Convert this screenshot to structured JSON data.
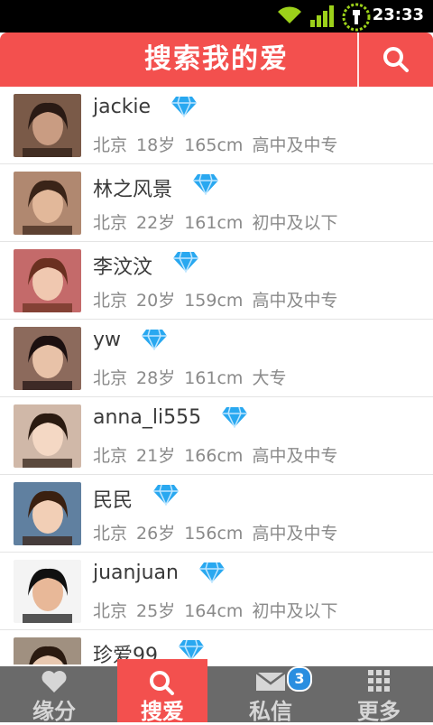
{
  "status_bar": {
    "time": "23:33"
  },
  "header": {
    "title": "搜索我的爱"
  },
  "profiles": [
    {
      "name": "jackie",
      "city": "北京",
      "age": "18岁",
      "height": "165cm",
      "education": "高中及中专"
    },
    {
      "name": "林之风景",
      "city": "北京",
      "age": "22岁",
      "height": "161cm",
      "education": "初中及以下"
    },
    {
      "name": "李汶汶",
      "city": "北京",
      "age": "20岁",
      "height": "159cm",
      "education": "高中及中专"
    },
    {
      "name": "yw",
      "city": "北京",
      "age": "28岁",
      "height": "161cm",
      "education": "大专"
    },
    {
      "name": "anna_li555",
      "city": "北京",
      "age": "21岁",
      "height": "166cm",
      "education": "高中及中专"
    },
    {
      "name": "民民",
      "city": "北京",
      "age": "26岁",
      "height": "156cm",
      "education": "高中及中专"
    },
    {
      "name": "juanjuan",
      "city": "北京",
      "age": "25岁",
      "height": "164cm",
      "education": "初中及以下"
    },
    {
      "name": "珍爱99",
      "city": "",
      "age": "",
      "height": "",
      "education": ""
    }
  ],
  "bottom_nav": {
    "items": [
      {
        "label": "缘分",
        "icon": "heart-icon"
      },
      {
        "label": "搜爱",
        "icon": "search-icon"
      },
      {
        "label": "私信",
        "icon": "mail-icon",
        "badge": "3"
      },
      {
        "label": "更多",
        "icon": "grid-icon"
      }
    ]
  },
  "colors": {
    "accent": "#f3504e",
    "nav_bg": "#6a6a6a",
    "diamond": "#29a8f0",
    "badge": "#2a8ee0"
  }
}
